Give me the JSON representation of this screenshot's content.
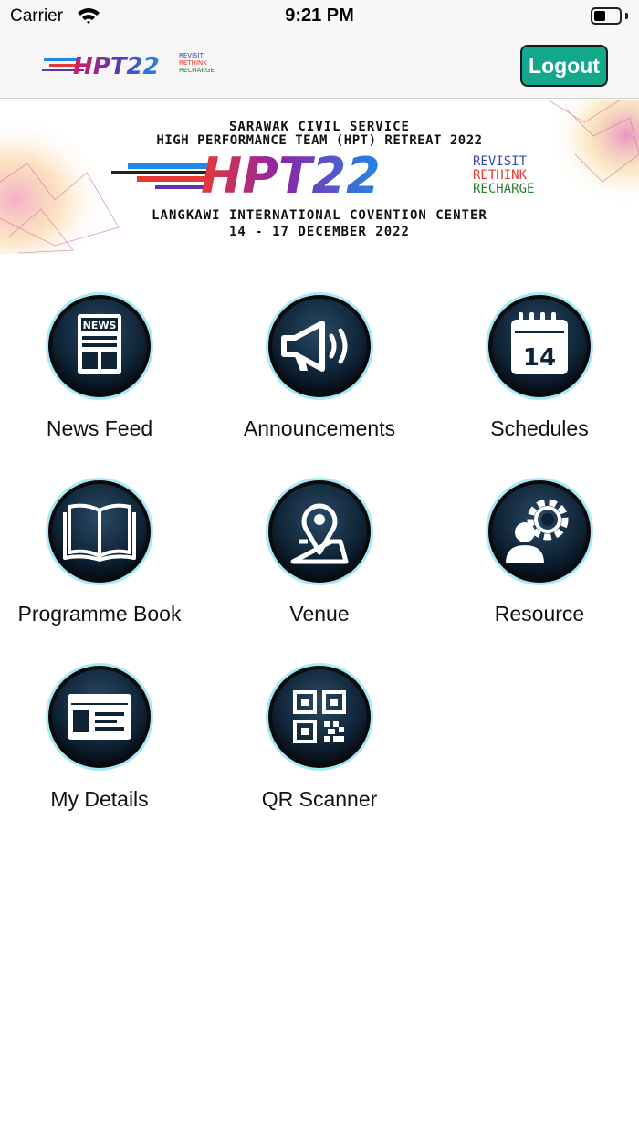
{
  "status_bar": {
    "carrier": "Carrier",
    "time": "9:21 PM",
    "battery_level": 0.45
  },
  "nav": {
    "logout_label": "Logout",
    "logo_text": "HPT22",
    "logo_tagline": [
      "REVISIT",
      "RETHINK",
      "RECHARGE"
    ]
  },
  "banner": {
    "line1": "SARAWAK CIVIL SERVICE",
    "line2": "HIGH PERFORMANCE TEAM (HPT) RETREAT 2022",
    "logo_text": "HPT22",
    "tagline": [
      "REVISIT",
      "RETHINK",
      "RECHARGE"
    ],
    "line3": "LANGKAWI INTERNATIONAL COVENTION CENTER",
    "line4": "14 - 17 DECEMBER 2022"
  },
  "menu": [
    {
      "label": "News Feed",
      "icon": "newspaper-icon",
      "icon_text": "NEWS"
    },
    {
      "label": "Announcements",
      "icon": "megaphone-icon"
    },
    {
      "label": "Schedules",
      "icon": "calendar-icon",
      "icon_text": "14"
    },
    {
      "label": "Programme Book",
      "icon": "book-icon"
    },
    {
      "label": "Venue",
      "icon": "map-pin-icon"
    },
    {
      "label": "Resource",
      "icon": "person-gear-icon"
    },
    {
      "label": "My Details",
      "icon": "id-card-icon"
    },
    {
      "label": "QR Scanner",
      "icon": "qr-code-icon"
    }
  ],
  "colors": {
    "accent": "#12a88c",
    "icon_ring": "#5fd8f0",
    "icon_bg": "#0f2336"
  }
}
